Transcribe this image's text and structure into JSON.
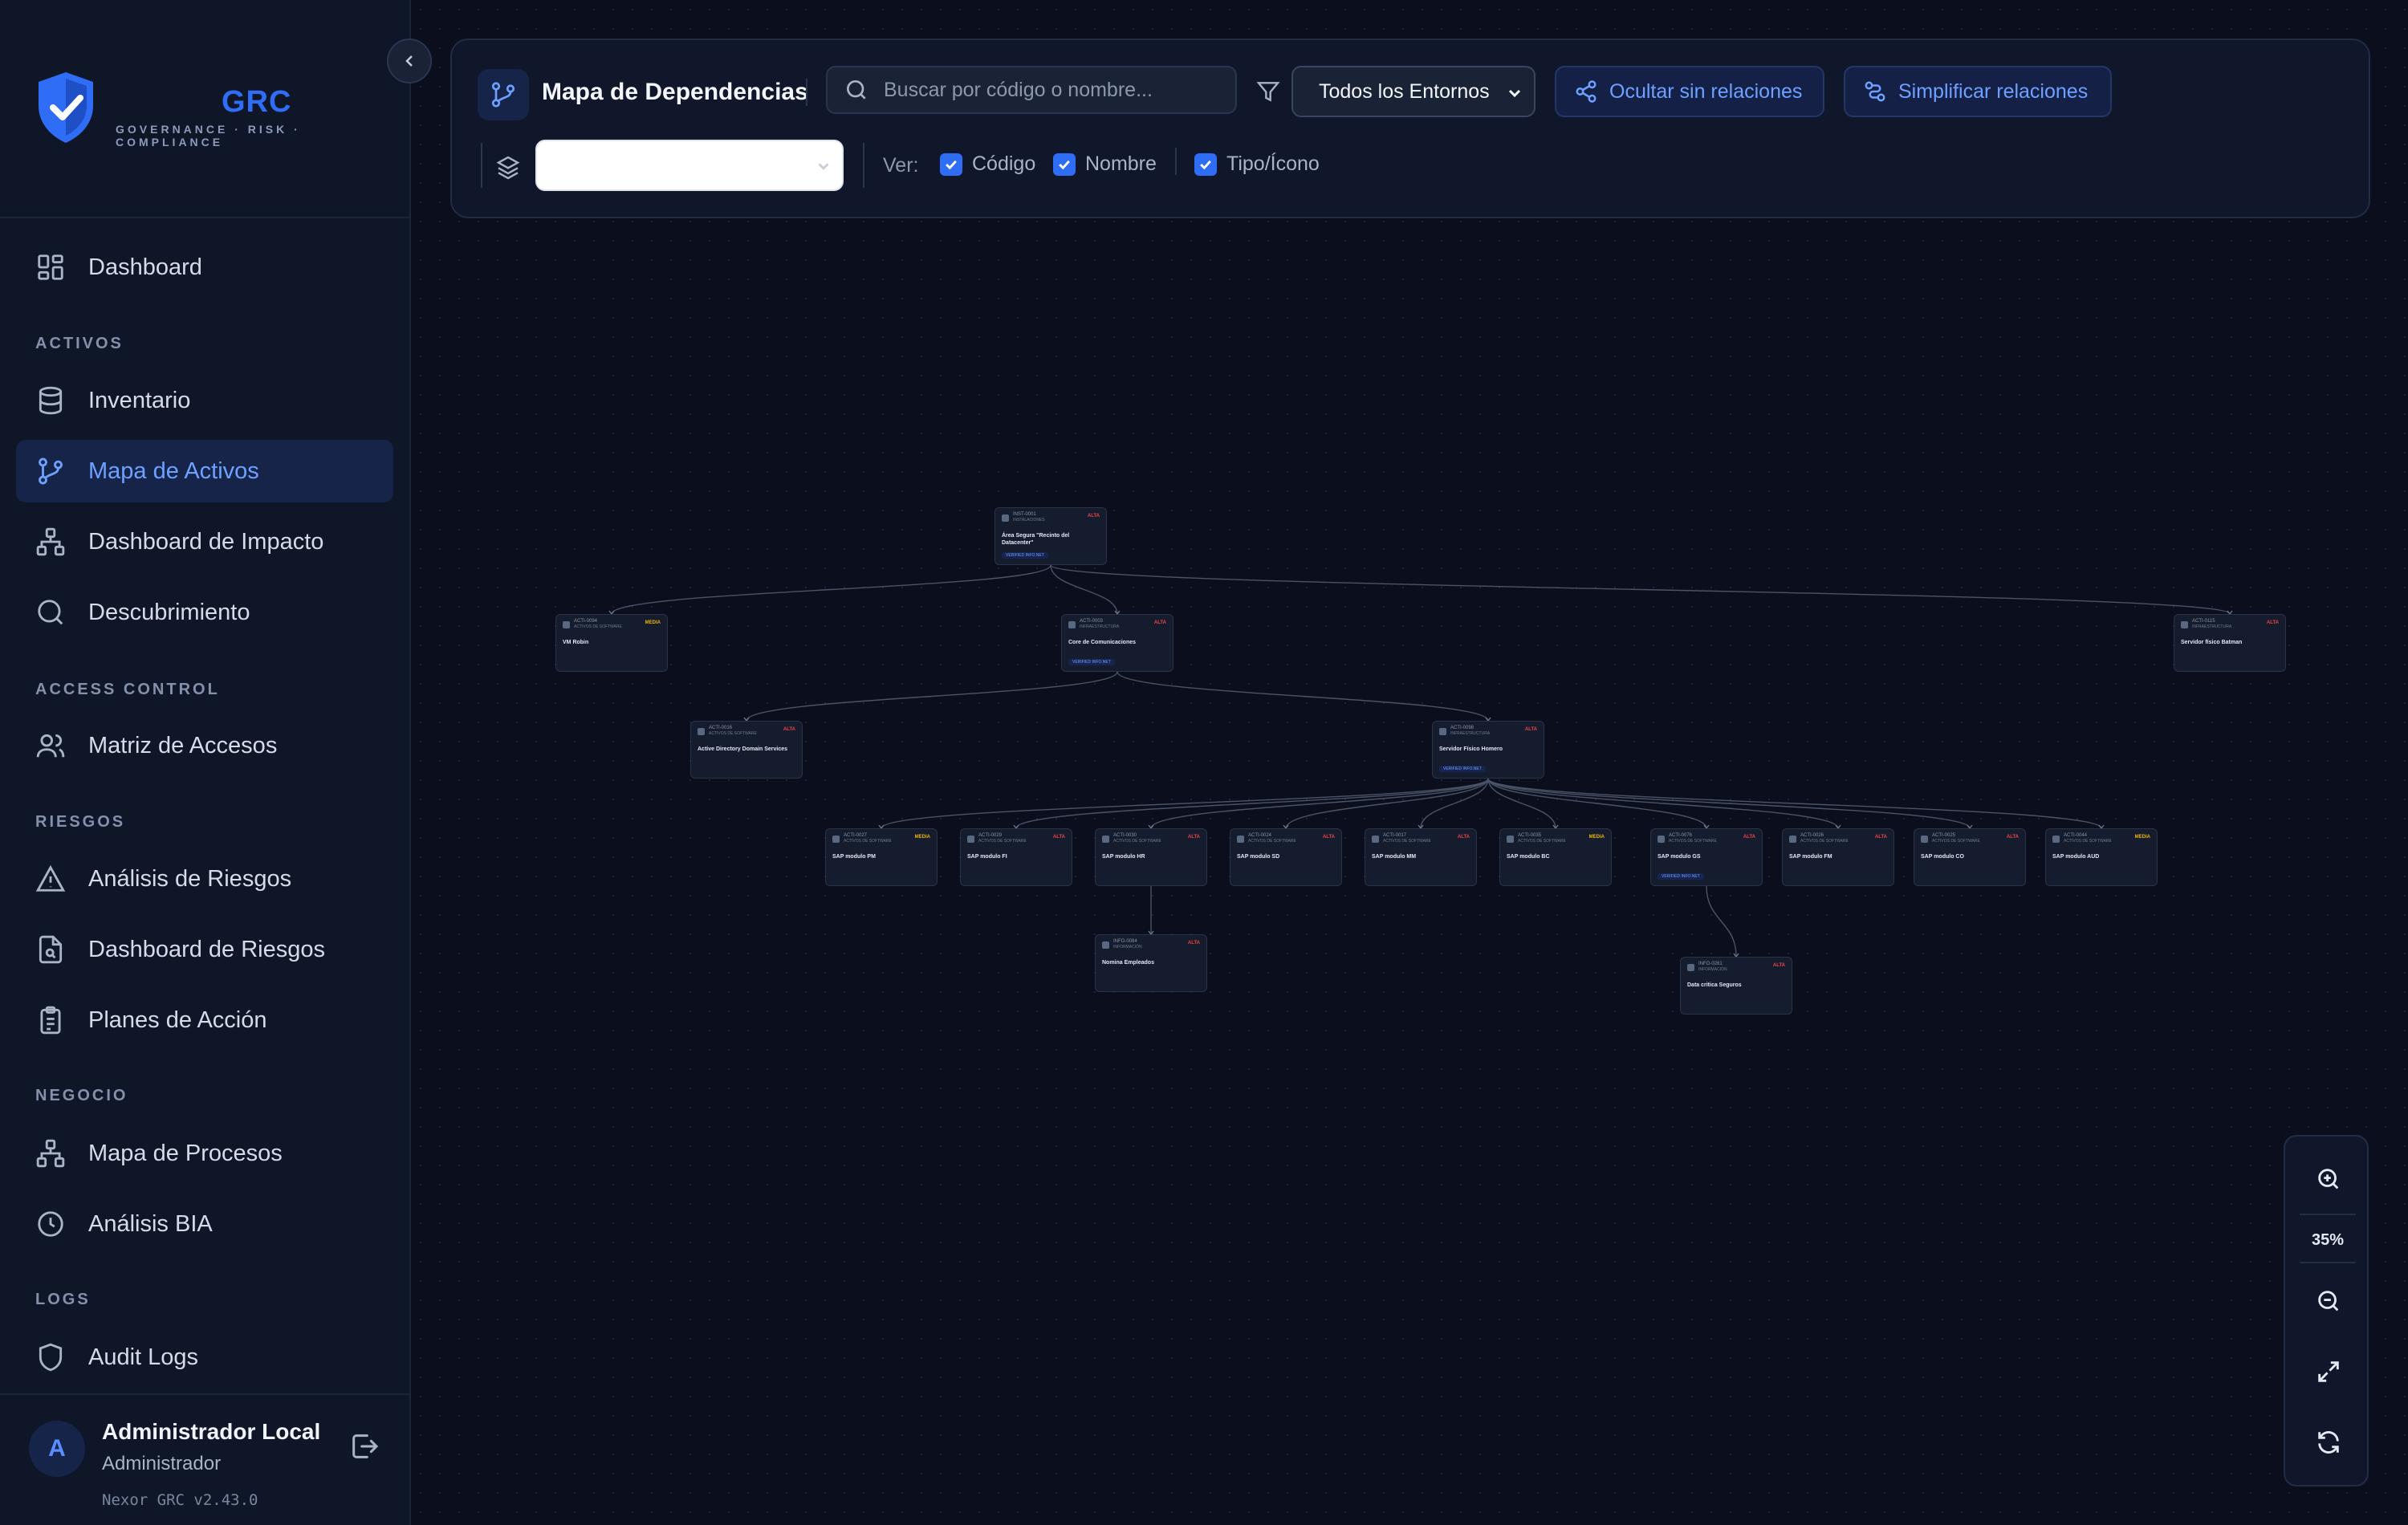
{
  "brand": {
    "title": "GRC",
    "subtitle": "GOVERNANCE · RISK · COMPLIANCE"
  },
  "sidebar": {
    "dashboard": "Dashboard",
    "sections": {
      "activos": "ACTIVOS",
      "access": "ACCESS CONTROL",
      "riesgos": "RIESGOS",
      "negocio": "NEGOCIO",
      "logs": "LOGS"
    },
    "items": {
      "inventario": "Inventario",
      "mapa_activos": "Mapa de Activos",
      "dashboard_impacto": "Dashboard de Impacto",
      "descubrimiento": "Descubrimiento",
      "matriz_accesos": "Matriz de Accesos",
      "analisis_riesgos": "Análisis de Riesgos",
      "dashboard_riesgos": "Dashboard de Riesgos",
      "planes_accion": "Planes de Acción",
      "mapa_procesos": "Mapa de Procesos",
      "analisis_bia": "Análisis BIA",
      "audit_logs": "Audit Logs"
    },
    "user": {
      "initial": "A",
      "name": "Administrador Local",
      "role": "Administrador",
      "version": "Nexor GRC v2.43.0"
    }
  },
  "toolbar": {
    "title": "Mapa de Dependencias",
    "search_placeholder": "Buscar por código o nombre...",
    "environment": "Todos los Entornos",
    "hide_button": "Ocultar sin relaciones",
    "simplify_button": "Simplificar relaciones",
    "layer_value": "",
    "ver_label": "Ver:",
    "checks": {
      "codigo": "Código",
      "nombre": "Nombre",
      "tipo": "Tipo/Ícono"
    }
  },
  "zoom": {
    "level": "35%"
  },
  "colors": {
    "alta": "#ef4444",
    "media": "#eab308",
    "accent": "#2f6df6"
  },
  "graph": {
    "nodes": [
      {
        "id": "n1",
        "code": "INST-0001",
        "type": "INSTALACIONES",
        "name": "Área Segura \"Recinto del Datacenter\"",
        "crit": "ALTA",
        "env": "VERIFIED INFO.NET"
      },
      {
        "id": "n2",
        "code": "ACTI-0094",
        "type": "ACTIVOS DE SOFTWARE",
        "name": "VM Robin",
        "crit": "MEDIA",
        "env": ""
      },
      {
        "id": "n3",
        "code": "ACTI-0003",
        "type": "INFRAESTRUCTURA",
        "name": "Core de Comunicaciones",
        "crit": "ALTA",
        "env": "VERIFIED INFO.NET"
      },
      {
        "id": "n4",
        "code": "ACTI-0115",
        "type": "INFRAESTRUCTURA",
        "name": "Servidor físico Batman",
        "crit": "ALTA",
        "env": ""
      },
      {
        "id": "n5",
        "code": "ACTI-0016",
        "type": "ACTIVOS DE SOFTWARE",
        "name": "Active Directory Domain Services",
        "crit": "ALTA",
        "env": ""
      },
      {
        "id": "n6",
        "code": "ACTI-0098",
        "type": "INFRAESTRUCTURA",
        "name": "Servidor Físico Homero",
        "crit": "ALTA",
        "env": "VERIFIED INFO.NET"
      },
      {
        "id": "n7",
        "code": "ACTI-0027",
        "type": "ACTIVOS DE SOFTWARE",
        "name": "SAP modulo PM",
        "crit": "MEDIA",
        "env": ""
      },
      {
        "id": "n8",
        "code": "ACTI-0029",
        "type": "ACTIVOS DE SOFTWARE",
        "name": "SAP modulo FI",
        "crit": "ALTA",
        "env": ""
      },
      {
        "id": "n9",
        "code": "ACTI-0030",
        "type": "ACTIVOS DE SOFTWARE",
        "name": "SAP modulo HR",
        "crit": "ALTA",
        "env": ""
      },
      {
        "id": "n10",
        "code": "ACTI-0024",
        "type": "ACTIVOS DE SOFTWARE",
        "name": "SAP modulo SD",
        "crit": "ALTA",
        "env": ""
      },
      {
        "id": "n11",
        "code": "ACTI-0017",
        "type": "ACTIVOS DE SOFTWARE",
        "name": "SAP modulo MM",
        "crit": "ALTA",
        "env": ""
      },
      {
        "id": "n12",
        "code": "ACTI-0035",
        "type": "ACTIVOS DE SOFTWARE",
        "name": "SAP modulo BC",
        "crit": "MEDIA",
        "env": ""
      },
      {
        "id": "n13",
        "code": "ACTI-0076",
        "type": "ACTIVOS DE SOFTWARE",
        "name": "SAP modulo GS",
        "crit": "ALTA",
        "env": "VERIFIED INFO.NET"
      },
      {
        "id": "n14",
        "code": "ACTI-0026",
        "type": "ACTIVOS DE SOFTWARE",
        "name": "SAP modulo FM",
        "crit": "ALTA",
        "env": ""
      },
      {
        "id": "n15",
        "code": "ACTI-0025",
        "type": "ACTIVOS DE SOFTWARE",
        "name": "SAP modulo CO",
        "crit": "ALTA",
        "env": ""
      },
      {
        "id": "n16",
        "code": "ACTI-0044",
        "type": "ACTIVOS DE SOFTWARE",
        "name": "SAP modulo AUD",
        "crit": "MEDIA",
        "env": ""
      },
      {
        "id": "n17",
        "code": "INFO-0084",
        "type": "INFORMACIÓN",
        "name": "Nomina Empleados",
        "crit": "ALTA",
        "env": ""
      },
      {
        "id": "n18",
        "code": "INFO-0261",
        "type": "INFORMACIÓN",
        "name": "Data critica Seguros",
        "crit": "ALTA",
        "env": ""
      }
    ],
    "edges": [
      [
        "n1",
        "n2"
      ],
      [
        "n1",
        "n3"
      ],
      [
        "n1",
        "n4"
      ],
      [
        "n3",
        "n5"
      ],
      [
        "n3",
        "n6"
      ],
      [
        "n6",
        "n7"
      ],
      [
        "n6",
        "n8"
      ],
      [
        "n6",
        "n9"
      ],
      [
        "n6",
        "n10"
      ],
      [
        "n6",
        "n11"
      ],
      [
        "n6",
        "n12"
      ],
      [
        "n6",
        "n13"
      ],
      [
        "n6",
        "n14"
      ],
      [
        "n6",
        "n15"
      ],
      [
        "n6",
        "n16"
      ],
      [
        "n9",
        "n17"
      ],
      [
        "n13",
        "n18"
      ]
    ]
  }
}
